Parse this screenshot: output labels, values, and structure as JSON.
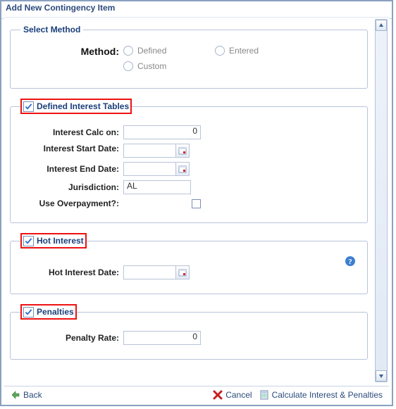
{
  "window": {
    "title": "Add New Contingency Item"
  },
  "select_method": {
    "legend": "Select Method",
    "label": "Method:",
    "options": {
      "defined": "Defined",
      "entered": "Entered",
      "custom": "Custom"
    }
  },
  "defined_interest": {
    "legend": "Defined Interest Tables",
    "checked": true,
    "interest_calc_label": "Interest Calc on:",
    "interest_calc_value": "0",
    "start_date_label": "Interest Start Date:",
    "start_date_value": "",
    "end_date_label": "Interest End Date:",
    "end_date_value": "",
    "jurisdiction_label": "Jurisdiction:",
    "jurisdiction_value": "AL",
    "overpayment_label": "Use Overpayment?:",
    "overpayment_checked": false
  },
  "hot_interest": {
    "legend": "Hot Interest",
    "checked": true,
    "date_label": "Hot Interest Date:",
    "date_value": ""
  },
  "penalties": {
    "legend": "Penalties",
    "checked": true,
    "rate_label": "Penalty Rate:",
    "rate_value": "0"
  },
  "footer": {
    "back": "Back",
    "cancel": "Cancel",
    "calculate": "Calculate Interest & Penalties"
  }
}
